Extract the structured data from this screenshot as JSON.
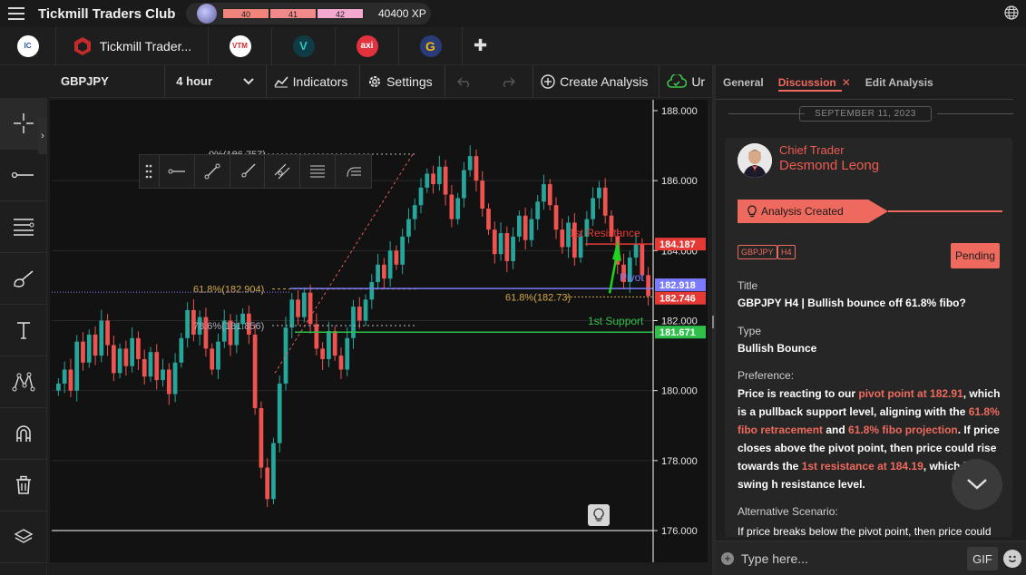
{
  "topbar": {
    "brand": "Tickmill Traders Club",
    "xp_levels": [
      "40",
      "41",
      "42"
    ],
    "xp_value": "40400 XP",
    "icons": [
      "hamburger-icon",
      "globe-icon"
    ]
  },
  "tabs": [
    {
      "name": "icmarkets",
      "label": "",
      "color": "#ffffff",
      "text_color": "#2456b2",
      "logo_text": "IC"
    },
    {
      "name": "tickmill",
      "label": "Tickmill Trader...",
      "color": "#c42b2b",
      "logo_text": ""
    },
    {
      "name": "broker-red",
      "label": "",
      "color": "#ffffff",
      "text_color": "#d42a2a",
      "logo_text": "VTM"
    },
    {
      "name": "vantage",
      "label": "",
      "color": "#0f3b45",
      "text_color": "#2ec4c4",
      "logo_text": "V"
    },
    {
      "name": "axi",
      "label": "",
      "color": "#e2323e",
      "text_color": "#ffffff",
      "logo_text": "axi"
    },
    {
      "name": "broker-g",
      "label": "",
      "color": "#2a3b7a",
      "text_color": "#f5b800",
      "logo_text": "G"
    }
  ],
  "chart_toolbar": {
    "symbol": "GBPJPY",
    "timeframe": "4 hour",
    "indicators": "Indicators",
    "settings": "Settings",
    "create_analysis": "Create Analysis",
    "upload_partial": "Ur"
  },
  "chart_data": {
    "type": "candlestick",
    "symbol": "GBPJPY",
    "y_ticks": [
      "188.000",
      "186.000",
      "184.000",
      "182.000",
      "180.000",
      "178.000",
      "176.000"
    ],
    "ylim": [
      176.0,
      188.0
    ],
    "price_labels": {
      "resistance": "184.187",
      "pivot": "182.918",
      "current": "182.746",
      "support": "181.671"
    },
    "annotations": {
      "fib_0": "0%(186.757)",
      "fib_618": "61.8%(182.904)",
      "fib_786": "78.6%(181.856)",
      "proj_618": "61.8%(182.73)",
      "resistance_label": "1st Resistance",
      "pivot_label": "Pivot",
      "support_label": "1st Support"
    },
    "levels": {
      "resistance": 184.187,
      "pivot": 182.918,
      "support": 181.671,
      "fib_0": 186.757,
      "fib_618": 182.904,
      "fib_786": 181.856,
      "proj_618": 182.73
    },
    "colors": {
      "up": "#26a69a",
      "down": "#ef5350",
      "resistance": "#e53935",
      "pivot": "#7b7bff",
      "support": "#2ec04a",
      "fib": "#d4a84a"
    },
    "close_path": [
      180.2,
      180.6,
      180.0,
      181.4,
      180.8,
      181.6,
      181.0,
      182.0,
      181.3,
      180.5,
      181.2,
      180.7,
      181.5,
      180.9,
      180.4,
      181.1,
      180.3,
      180.6,
      179.9,
      180.8,
      181.5,
      182.3,
      181.6,
      182.1,
      181.2,
      180.6,
      181.4,
      182.0,
      181.3,
      181.9,
      182.2,
      181.6,
      179.5,
      177.8,
      176.9,
      178.5,
      180.2,
      181.8,
      182.6,
      182.1,
      182.8,
      181.9,
      181.2,
      180.9,
      181.7,
      181.0,
      180.6,
      181.5,
      182.4,
      182.0,
      182.6,
      183.1,
      183.6,
      183.2,
      184.0,
      183.6,
      184.4,
      184.9,
      185.3,
      185.8,
      186.2,
      185.9,
      186.4,
      185.6,
      184.9,
      185.5,
      186.3,
      186.7,
      186.0,
      185.2,
      184.6,
      183.9,
      184.5,
      183.7,
      184.4,
      185.0,
      184.3,
      184.9,
      185.4,
      185.9,
      185.3,
      184.6,
      184.1,
      184.8,
      183.8,
      184.4,
      184.9,
      185.5,
      185.8,
      185.0,
      184.4,
      183.6,
      183.1,
      183.8,
      184.2,
      183.3,
      182.7
    ]
  },
  "right_panel": {
    "tabs": {
      "general": "General",
      "discussion": "Discussion",
      "edit": "Edit Analysis"
    },
    "date": "SEPTEMBER 11, 2023",
    "author_role": "Chief Trader",
    "author_name": "Desmond Leong",
    "status_banner": "Analysis Created",
    "tags": [
      "GBPJPY",
      "H4"
    ],
    "status": "Pending",
    "title_label": "Title",
    "title_value": "GBPJPY H4 | Bullish bounce off 61.8% fibo?",
    "type_label": "Type",
    "type_value": "Bullish Bounce",
    "pref_label": "Preference:",
    "pref_parts": [
      {
        "t": "Price is reacting to our ",
        "hl": false
      },
      {
        "t": "pivot point at 182.91",
        "hl": true
      },
      {
        "t": ", which is a pullback support level, aligning with the ",
        "hl": false
      },
      {
        "t": "61.8% fibo retracement",
        "hl": true
      },
      {
        "t": " and ",
        "hl": false
      },
      {
        "t": "61.8% fibo projection",
        "hl": true
      },
      {
        "t": ". If price closes above the pivot point, then price could rise towards the ",
        "hl": false
      },
      {
        "t": "1st resistance at 184.19",
        "hl": true
      },
      {
        "t": ", which is a swing h",
        "hl": false
      },
      {
        "t": " resistance level.",
        "hl": false
      }
    ],
    "alt_label": "Alternative Scenario:",
    "alt_text": "If price breaks below the pivot point, then price could"
  },
  "input": {
    "placeholder": "Type here...",
    "gif": "GIF"
  }
}
